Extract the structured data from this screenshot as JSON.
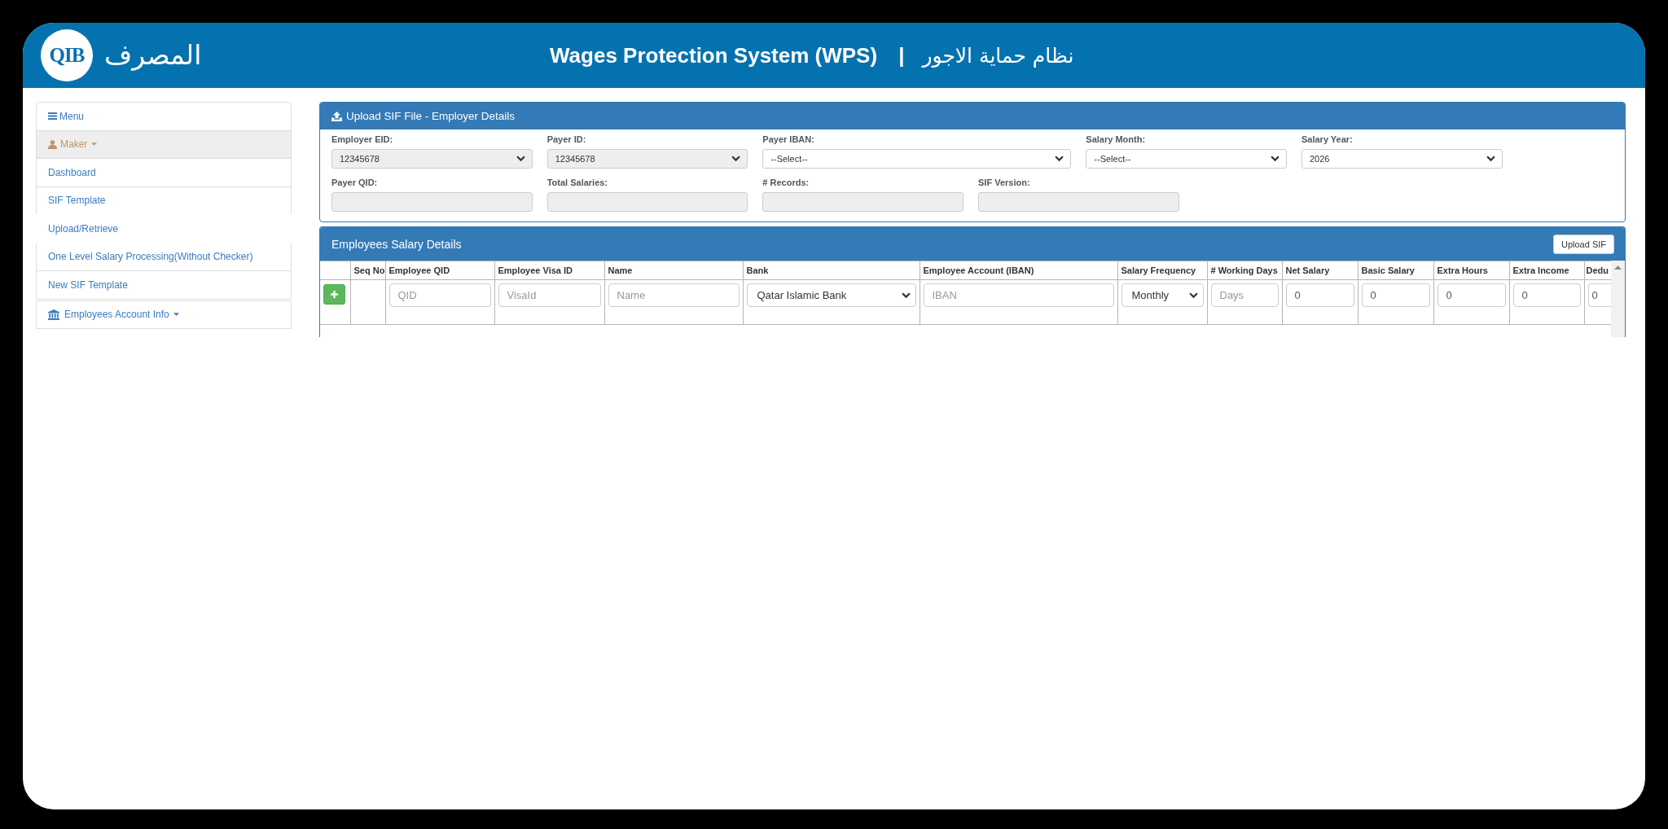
{
  "header": {
    "logo_mark": "QIB",
    "logo_name": "المصرف",
    "title": "Wages Protection System (WPS)",
    "separator": "|",
    "title_arabic": "نظام حماية الاجور"
  },
  "sidebar": {
    "heading": "Menu",
    "groups": [
      {
        "label": "Maker",
        "kind": "user",
        "expanded": true,
        "children": [
          {
            "label": "Dashboard",
            "selected": false
          },
          {
            "label": "SIF Template",
            "selected": false
          },
          {
            "label": "Upload/Retrieve",
            "selected": true
          },
          {
            "label": "One Level Salary Processing(Without Checker)",
            "selected": false
          },
          {
            "label": "New SIF Template",
            "selected": false
          }
        ]
      },
      {
        "label": "Employees Account Info",
        "kind": "bank",
        "expanded": false
      }
    ]
  },
  "employer_panel": {
    "title": "Upload SIF File - Employer Details",
    "rows": [
      [
        {
          "label": "Employer EID:",
          "kind": "select",
          "value": "12345678",
          "disabled": true
        },
        {
          "label": "Payer ID:",
          "kind": "select",
          "value": "12345678",
          "disabled": true
        },
        {
          "label": "Payer IBAN:",
          "kind": "select",
          "value": "--Select--",
          "disabled": false
        },
        {
          "label": "Salary Month:",
          "kind": "select",
          "value": "--Select--",
          "disabled": false
        },
        {
          "label": "Salary Year:",
          "kind": "select",
          "value": "2026",
          "disabled": false
        }
      ],
      [
        {
          "label": "Payer QID:",
          "kind": "input",
          "disabled": true
        },
        {
          "label": "Total Salaries:",
          "kind": "input",
          "disabled": true
        },
        {
          "label": "# Records:",
          "kind": "input",
          "disabled": true
        },
        {
          "label": "SIF Version:",
          "kind": "input",
          "disabled": true
        }
      ]
    ]
  },
  "salary_panel": {
    "title": "Employees Salary Details",
    "upload_button": "Upload SIF",
    "columns": [
      "Seq No",
      "Employee QID",
      "Employee Visa ID",
      "Name",
      "Bank",
      "Employee Account (IBAN)",
      "Salary Frequency",
      "# Working Days",
      "Net Salary",
      "Basic Salary",
      "Extra Hours",
      "Extra Income",
      "Dedu"
    ],
    "rows": [
      {
        "cells": [
          {
            "kind": "text"
          },
          {
            "kind": "input",
            "placeholder": "QID"
          },
          {
            "kind": "input",
            "placeholder": "VisaId"
          },
          {
            "kind": "input",
            "placeholder": "Name"
          },
          {
            "kind": "select",
            "value": "Qatar Islamic Bank"
          },
          {
            "kind": "input",
            "placeholder": "IBAN"
          },
          {
            "kind": "select",
            "value": "Monthly"
          },
          {
            "kind": "input",
            "placeholder": "Days"
          },
          {
            "kind": "input",
            "value": "0"
          },
          {
            "kind": "input",
            "value": "0"
          },
          {
            "kind": "input",
            "value": "0"
          },
          {
            "kind": "input",
            "value": "0"
          },
          {
            "kind": "input",
            "value": "0"
          }
        ]
      }
    ]
  }
}
